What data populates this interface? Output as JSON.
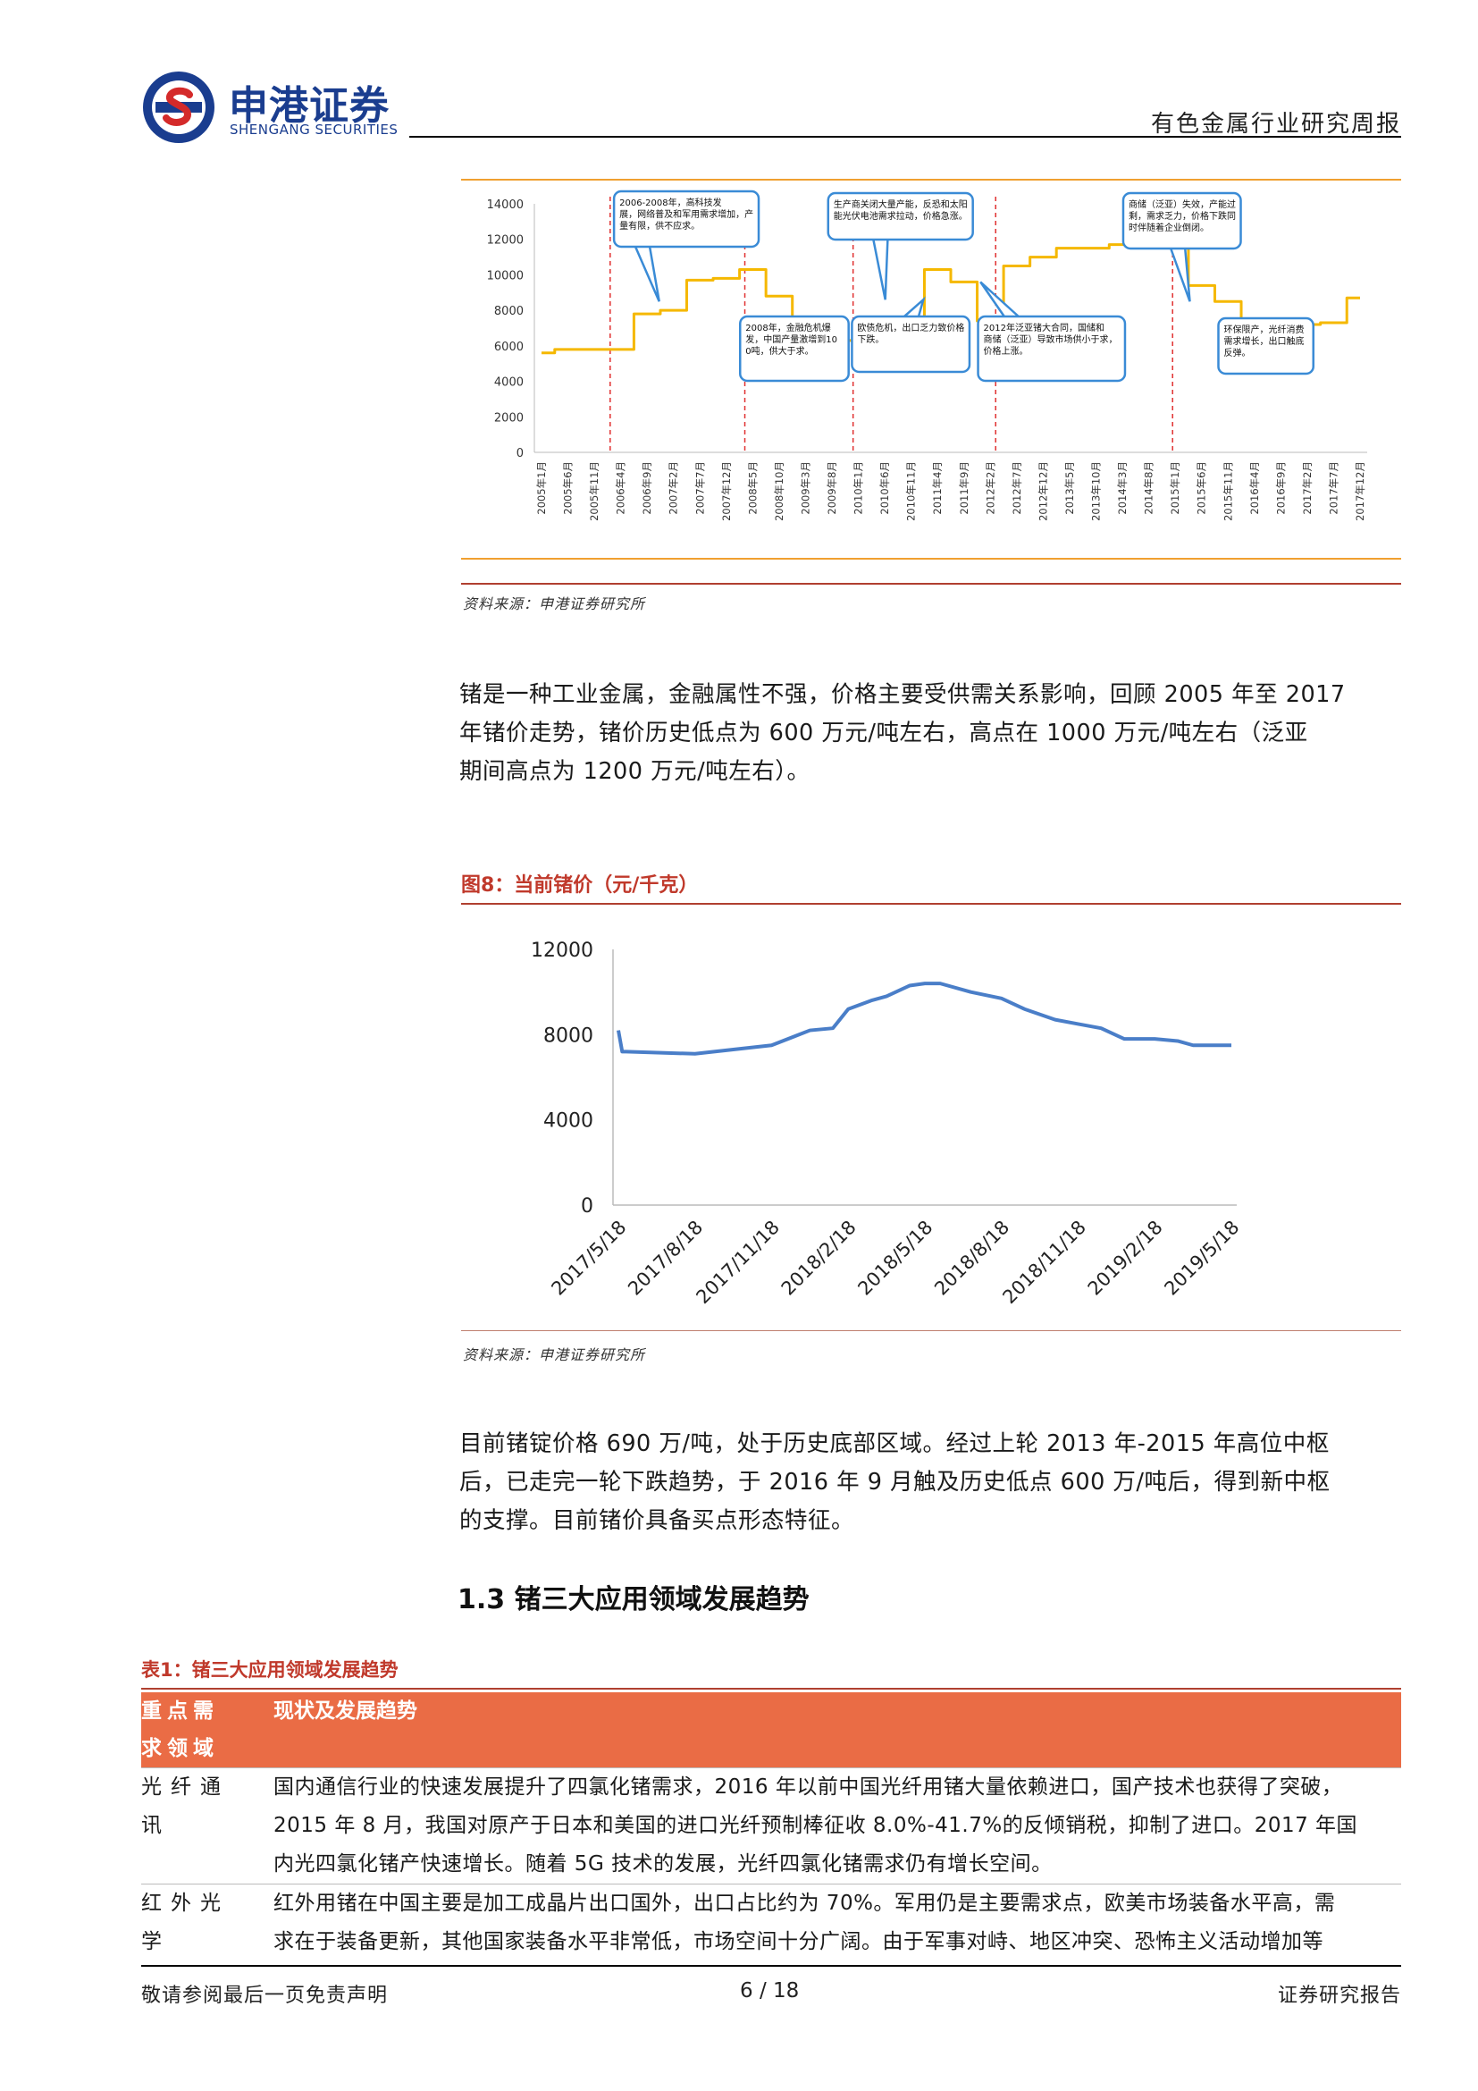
{
  "header": {
    "brand_cn": "申港证券",
    "brand_en": "SHENGANG SECURITIES",
    "report_type": "有色金属行业研究周报"
  },
  "figure7": {
    "source": "资料来源：申港证券研究所",
    "chart_data": {
      "type": "line",
      "title": "",
      "xlabel": "",
      "ylabel": "",
      "ylim": [
        0,
        14000
      ],
      "yticks": [
        0,
        2000,
        4000,
        6000,
        8000,
        10000,
        12000,
        14000
      ],
      "categories": [
        "2005年1月",
        "2005年6月",
        "2005年11月",
        "2006年4月",
        "2006年9月",
        "2007年2月",
        "2007年7月",
        "2007年12月",
        "2008年5月",
        "2008年10月",
        "2009年3月",
        "2009年8月",
        "2010年1月",
        "2010年6月",
        "2010年11月",
        "2011年4月",
        "2011年9月",
        "2012年2月",
        "2012年7月",
        "2012年12月",
        "2013年5月",
        "2013年10月",
        "2014年3月",
        "2014年8月",
        "2015年1月",
        "2015年6月",
        "2015年11月",
        "2016年4月",
        "2016年9月",
        "2017年2月",
        "2017年7月",
        "2017年12月"
      ],
      "series": [
        {
          "color": "#f5b800",
          "values": [
            5600,
            5800,
            5800,
            5800,
            7800,
            8000,
            9700,
            9800,
            10300,
            8800,
            6800,
            6400,
            6300,
            5800,
            6100,
            10300,
            9600,
            7400,
            10500,
            11000,
            11500,
            11500,
            11700,
            12100,
            11800,
            9400,
            8500,
            7500,
            6100,
            7200,
            7300,
            8700
          ]
        }
      ],
      "annotations": [
        "2006-2008年，高科技发展，网络普及和军用需求增加，产量有限，供不应求。",
        "2008年，金融危机爆发，中国产量激增到100吨，供大于求。",
        "生产商关闭大量产能，反恐和太阳能光伏电池需求拉动，价格急涨。",
        "欧债危机，出口乏力致价格下跌。",
        "2012年泛亚锗大合同，国储和商储（泛亚）导致市场供小于求，价格上涨。",
        "商储（泛亚）失效，产能过剩，需求乏力，价格下跌同时伴随着企业倒闭。",
        "环保限产，光纤消费需求增长，出口触底反弹。"
      ]
    }
  },
  "para1": {
    "lines": [
      "锗是一种工业金属，金融属性不强，价格主要受供需关系影响，回顾 2005 年至 2017",
      "年锗价走势，锗价历史低点为 600 万元/吨左右，高点在 1000 万元/吨左右（泛亚",
      "期间高点为 1200 万元/吨左右）。"
    ]
  },
  "figure8": {
    "title": "图8：当前锗价（元/千克）",
    "source": "资料来源：申港证券研究所",
    "chart_data": {
      "type": "line",
      "title": "",
      "xlabel": "",
      "ylabel": "",
      "ylim": [
        0,
        12000
      ],
      "yticks": [
        0,
        4000,
        8000,
        12000
      ],
      "x_ticks": [
        "2017/5/18",
        "2017/8/18",
        "2017/11/18",
        "2018/2/18",
        "2018/5/18",
        "2018/8/18",
        "2018/11/18",
        "2019/2/18",
        "2019/5/18"
      ],
      "series": [
        {
          "color": "#4a7ec8",
          "x": [
            0,
            0.05,
            0.1,
            1.0,
            1.5,
            2.0,
            2.5,
            2.8,
            3.0,
            3.3,
            3.5,
            3.8,
            4.0,
            4.2,
            4.6,
            5.0,
            5.3,
            5.7,
            6.0,
            6.3,
            6.6,
            7.0,
            7.3,
            7.5,
            7.8,
            8.0
          ],
          "y": [
            8200,
            7200,
            7200,
            7100,
            7300,
            7500,
            8200,
            8300,
            9200,
            9600,
            9800,
            10300,
            10400,
            10400,
            10000,
            9700,
            9200,
            8700,
            8500,
            8300,
            7800,
            7800,
            7700,
            7500,
            7500,
            7500
          ]
        }
      ]
    }
  },
  "para2": {
    "lines": [
      "目前锗锭价格 690 万/吨，处于历史底部区域。经过上轮 2013 年-2015 年高位中枢",
      "后，已走完一轮下跌趋势，于 2016 年 9 月触及历史低点 600 万/吨后，得到新中枢",
      "的支撑。目前锗价具备买点形态特征。"
    ]
  },
  "section": {
    "title": "1.3 锗三大应用领域发展趋势"
  },
  "table1": {
    "title": "表1：锗三大应用领域发展趋势",
    "header": {
      "col1_line1": "重点需",
      "col1_line2": "求领域",
      "col2": "现状及发展趋势"
    },
    "rows": [
      {
        "field_line1": "光纤通",
        "field_line2": "讯",
        "lines": [
          "国内通信行业的快速发展提升了四氯化锗需求，2016 年以前中国光纤用锗大量依赖进口，国产技术也获得了突破，",
          "2015 年 8 月，我国对原产于日本和美国的进口光纤预制棒征收 8.0%-41.7%的反倾销税，抑制了进口。2017 年国",
          "内光四氯化锗产快速增长。随着 5G 技术的发展，光纤四氯化锗需求仍有增长空间。"
        ]
      },
      {
        "field_line1": "红外光",
        "field_line2": "学",
        "lines": [
          "红外用锗在中国主要是加工成晶片出口国外，出口占比约为 70%。军用仍是主要需求点，欧美市场装备水平高，需",
          "求在于装备更新，其他国家装备水平非常低，市场空间十分广阔。由于军事对峙、地区冲突、恐怖主义活动增加等"
        ]
      }
    ]
  },
  "footer": {
    "left": "敬请参阅最后一页免责声明",
    "page": "6 / 18",
    "right": "证券研究报告"
  }
}
